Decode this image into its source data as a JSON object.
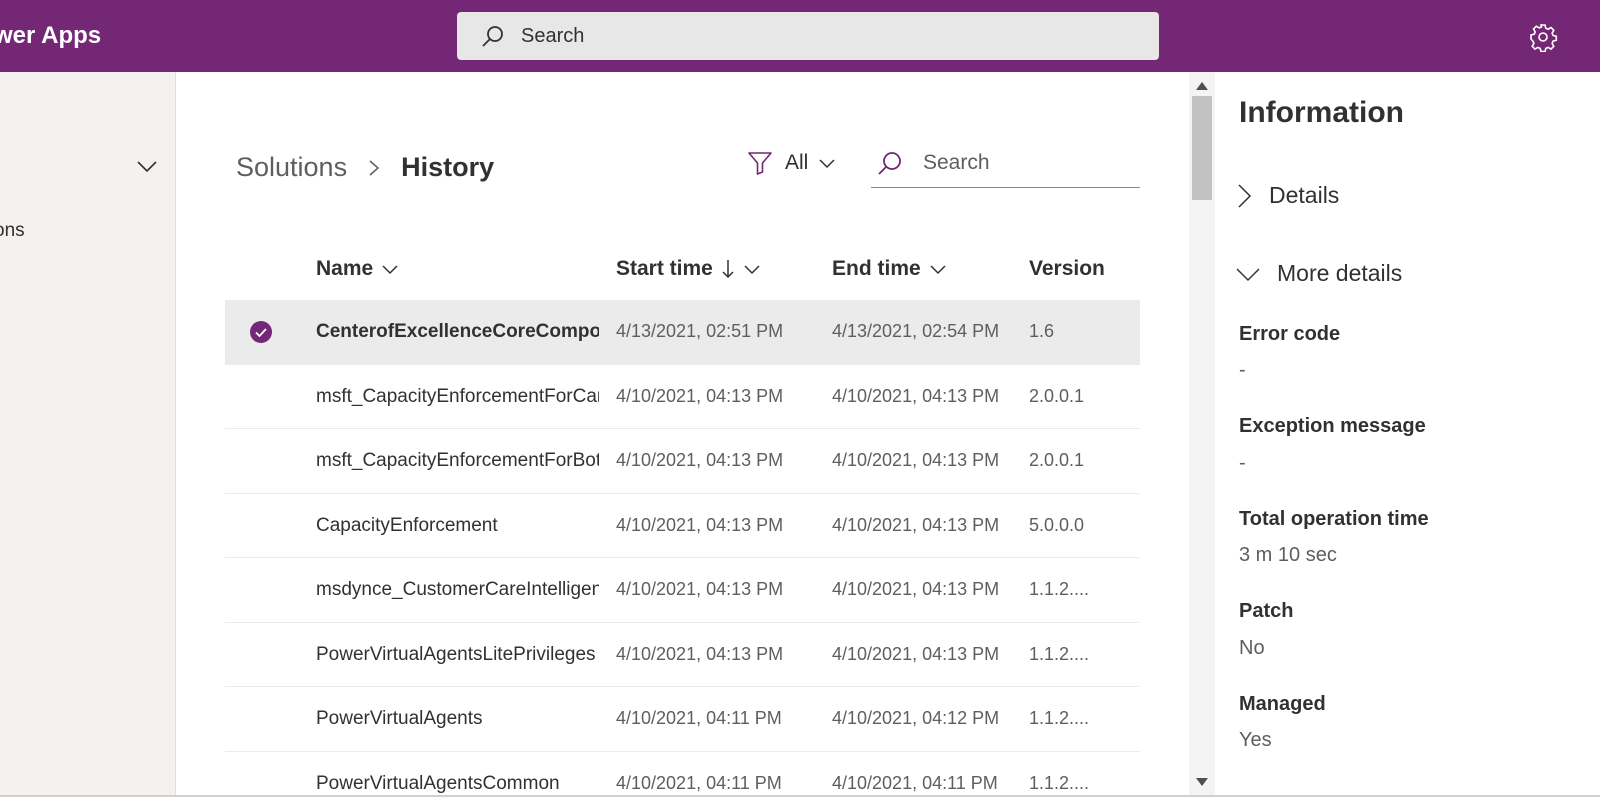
{
  "topbar": {
    "app_name": "wer Apps",
    "search_placeholder": "Search"
  },
  "sidebar": {
    "item_label": "ons"
  },
  "breadcrumb": {
    "parent": "Solutions",
    "current": "History"
  },
  "filter": {
    "label": "All"
  },
  "list_search": {
    "placeholder": "Search"
  },
  "table": {
    "columns": {
      "name": "Name",
      "start_time": "Start time",
      "end_time": "End time",
      "version": "Version"
    },
    "rows": [
      {
        "name": "CenterofExcellenceCoreComponents",
        "start": "4/13/2021, 02:51 PM",
        "end": "4/13/2021, 02:54 PM",
        "version": "1.6"
      },
      {
        "name": "msft_CapacityEnforcementForCanvas",
        "start": "4/10/2021, 04:13 PM",
        "end": "4/10/2021, 04:13 PM",
        "version": "2.0.0.1"
      },
      {
        "name": "msft_CapacityEnforcementForBots",
        "start": "4/10/2021, 04:13 PM",
        "end": "4/10/2021, 04:13 PM",
        "version": "2.0.0.1"
      },
      {
        "name": "CapacityEnforcement",
        "start": "4/10/2021, 04:13 PM",
        "end": "4/10/2021, 04:13 PM",
        "version": "5.0.0.0"
      },
      {
        "name": "msdynce_CustomerCareIntelligence",
        "start": "4/10/2021, 04:13 PM",
        "end": "4/10/2021, 04:13 PM",
        "version": "1.1.2...."
      },
      {
        "name": "PowerVirtualAgentsLitePrivileges",
        "start": "4/10/2021, 04:13 PM",
        "end": "4/10/2021, 04:13 PM",
        "version": "1.1.2...."
      },
      {
        "name": "PowerVirtualAgents",
        "start": "4/10/2021, 04:11 PM",
        "end": "4/10/2021, 04:12 PM",
        "version": "1.1.2...."
      },
      {
        "name": "PowerVirtualAgentsCommon",
        "start": "4/10/2021, 04:11 PM",
        "end": "4/10/2021, 04:11 PM",
        "version": "1.1.2...."
      }
    ]
  },
  "panel": {
    "title": "Information",
    "details_label": "Details",
    "more_details_label": "More details",
    "fields": [
      {
        "label": "Error code",
        "value": "-"
      },
      {
        "label": "Exception message",
        "value": "-"
      },
      {
        "label": "Total operation time",
        "value": "3 m 10 sec"
      },
      {
        "label": "Patch",
        "value": "No"
      },
      {
        "label": "Managed",
        "value": "Yes"
      }
    ]
  },
  "colors": {
    "brand": "#742774",
    "selected_row": "#ebebeb"
  }
}
